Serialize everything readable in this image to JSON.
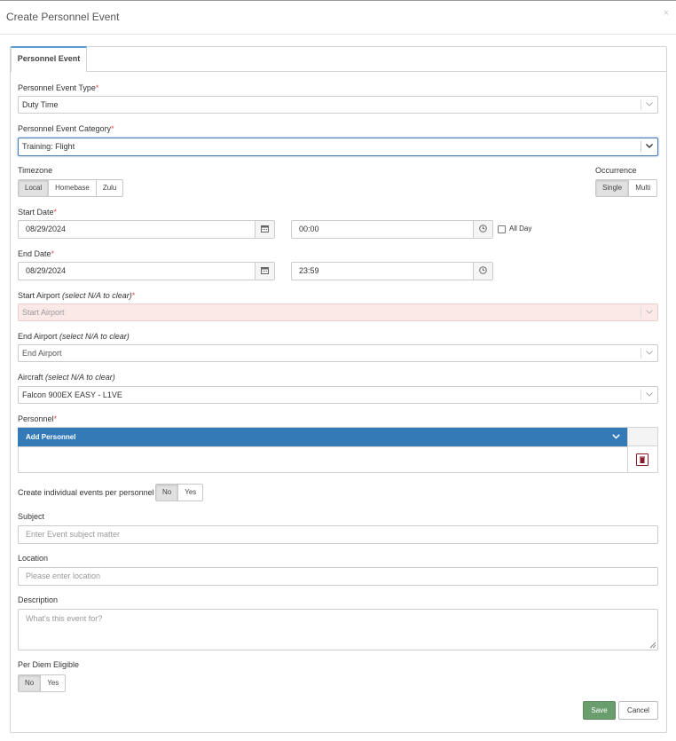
{
  "modal": {
    "title": "Create Personnel Event",
    "close": "×"
  },
  "tabs": [
    {
      "label": "Personnel Event"
    }
  ],
  "form": {
    "event_type": {
      "label": "Personnel Event Type",
      "required": "*",
      "value": "Duty Time"
    },
    "event_category": {
      "label": "Personnel Event Category",
      "required": "*",
      "value": "Training: Flight"
    },
    "timezone": {
      "label": "Timezone",
      "options": [
        "Local",
        "Homebase",
        "Zulu"
      ],
      "selected": "Local"
    },
    "occurrence": {
      "label": "Occurrence",
      "options": [
        "Single",
        "Multi"
      ],
      "selected": "Single"
    },
    "start_date": {
      "label": "Start Date",
      "required": "*",
      "date": "08/29/2024",
      "time": "00:00",
      "all_day_label": "All Day"
    },
    "end_date": {
      "label": "End Date",
      "required": "*",
      "date": "08/29/2024",
      "time": "23:59"
    },
    "start_airport": {
      "label": "Start Airport",
      "hint": "(select N/A to clear)",
      "required": "*",
      "placeholder": "Start Airport"
    },
    "end_airport": {
      "label": "End Airport",
      "hint": "(select N/A to clear)",
      "placeholder": "End Airport"
    },
    "aircraft": {
      "label": "Aircraft",
      "hint": "(select N/A to clear)",
      "value": "Falcon 900EX EASY - L1VE"
    },
    "personnel": {
      "label": "Personnel",
      "required": "*",
      "add_label": "Add Personnel"
    },
    "individual_events": {
      "label": "Create individual events per personnel",
      "options": [
        "No",
        "Yes"
      ],
      "selected": "No"
    },
    "subject": {
      "label": "Subject",
      "placeholder": "Enter Event subject matter"
    },
    "location": {
      "label": "Location",
      "placeholder": "Please enter location"
    },
    "description": {
      "label": "Description",
      "placeholder": "What's this event for?"
    },
    "per_diem": {
      "label": "Per Diem Eligible",
      "options": [
        "No",
        "Yes"
      ],
      "selected": "No"
    }
  },
  "actions": {
    "save": "Save",
    "cancel": "Cancel"
  },
  "colors": {
    "primary_bar": "#337ab7",
    "save_button": "#6b9e6f",
    "required": "#d9534f",
    "delete_icon": "#8b1a2b",
    "error_field": "#fbe9e8"
  }
}
